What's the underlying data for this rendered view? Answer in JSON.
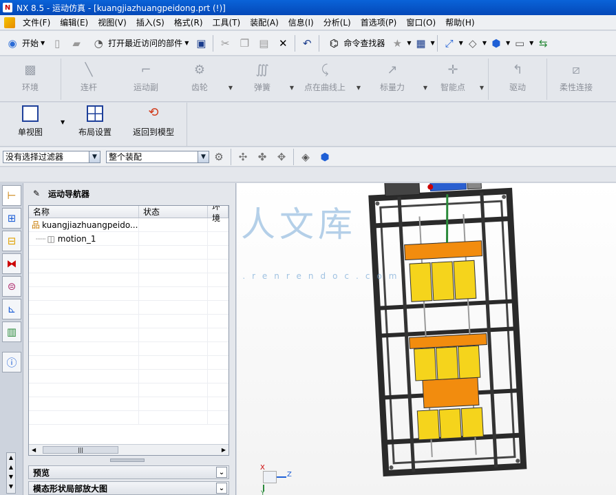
{
  "window": {
    "title": "NX 8.5 - 运动仿真 - [kuangjiazhuangpeidong.prt   (!)]"
  },
  "menu": {
    "items": [
      "文件(F)",
      "编辑(E)",
      "视图(V)",
      "插入(S)",
      "格式(R)",
      "工具(T)",
      "装配(A)",
      "信息(I)",
      "分析(L)",
      "首选项(P)",
      "窗口(O)",
      "帮助(H)"
    ]
  },
  "standard_toolbar": {
    "start_label": "开始",
    "recent_label": "打开最近访问的部件",
    "command_finder_label": "命令查找器"
  },
  "motion_toolbar": {
    "items": [
      "环境",
      "连杆",
      "运动副",
      "齿轮",
      "弹簧",
      "点在曲线上",
      "标量力",
      "智能点",
      "驱动",
      "柔性连接"
    ]
  },
  "layout_toolbar": {
    "items": [
      "单视图",
      "布局设置",
      "返回到模型"
    ]
  },
  "selection_bar": {
    "filter_value": "没有选择过滤器",
    "scope_value": "整个装配"
  },
  "navigator": {
    "title": "运动导航器",
    "columns": [
      "名称",
      "状态",
      "环境"
    ],
    "rows": [
      {
        "name": "kuangjiazhuangpeido...",
        "icon": "assembly-icon"
      },
      {
        "name": "motion_1",
        "icon": "motion-icon"
      }
    ],
    "panels": [
      "预览",
      "模态形状局部放大图"
    ]
  },
  "viewport": {
    "watermark_text": "人人文库",
    "watermark_url": "www.renrendoc.com",
    "triad_labels": {
      "x": "X",
      "y": "Y",
      "z": "Z"
    }
  },
  "colors": {
    "title_bar": "#0448b8",
    "frame": "#2a2a2a",
    "block": "#f5d41c",
    "orange": "#f28c0e",
    "accent_blue": "#1e5fd6"
  }
}
